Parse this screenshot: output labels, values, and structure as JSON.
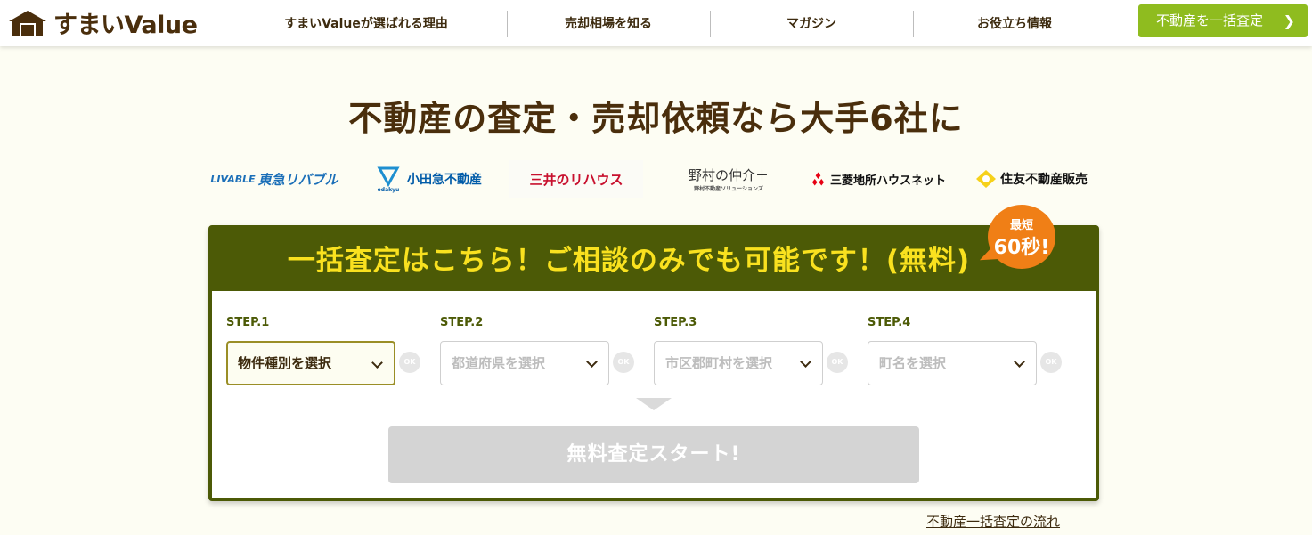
{
  "header": {
    "logo_text": "すまいValue",
    "nav": [
      "すまいValueが選ばれる理由",
      "売却相場を知る",
      "マガジン",
      "お役立ち情報"
    ],
    "cta_label": "不動産を一括査定",
    "cta_color": "#8fbc1f"
  },
  "hero": {
    "title": "不動産の査定・売却依頼なら大手6社に"
  },
  "brands": [
    {
      "label": "東急リバブル",
      "prefix": "LIVABLE",
      "color": "#1b6fb8"
    },
    {
      "label": "小田急不動産",
      "sub": "odakyu",
      "color": "#005ba8"
    },
    {
      "label": "三井のリハウス",
      "color": "#c8102e"
    },
    {
      "label": "野村の仲介＋",
      "sub": "野村不動産ソリューションズ",
      "color": "#333333"
    },
    {
      "label": "三菱地所ハウスネット",
      "color": "#111111"
    },
    {
      "label": "住友不動産販売",
      "color": "#111111"
    }
  ],
  "form": {
    "title": "一括査定はこちら！ご相談のみでも可能です！(無料)",
    "badge_line1": "最短",
    "badge_line2": "60秒!",
    "steps": [
      {
        "label": "STEP.1",
        "placeholder": "物件種別を選択",
        "active": true
      },
      {
        "label": "STEP.2",
        "placeholder": "都道府県を選択",
        "active": false
      },
      {
        "label": "STEP.3",
        "placeholder": "市区郡町村を選択",
        "active": false
      },
      {
        "label": "STEP.4",
        "placeholder": "町名を選択",
        "active": false
      }
    ],
    "ok_text": "OK",
    "start_label": "無料査定スタート!",
    "panel_color": "#4c5a06",
    "title_color": "#f9e11f",
    "badge_color": "#f07f16"
  },
  "flow_link": "不動産一括査定の流れ"
}
